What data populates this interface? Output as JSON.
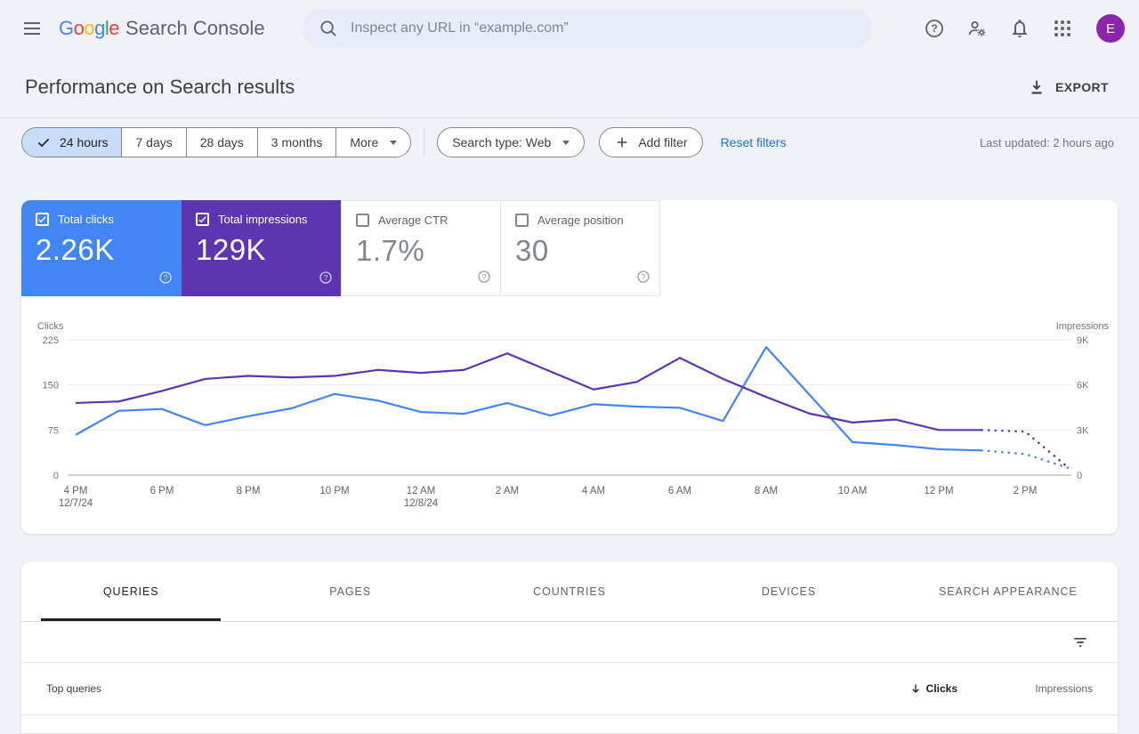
{
  "topbar": {
    "logo_letters": [
      "G",
      "o",
      "o",
      "g",
      "l",
      "e"
    ],
    "logo_product": "Search Console",
    "search_placeholder": "Inspect any URL in “example.com”",
    "avatar_letter": "E"
  },
  "header": {
    "title": "Performance on Search results",
    "export_label": "EXPORT"
  },
  "filters": {
    "date_chips": [
      {
        "label": "24 hours",
        "selected": true
      },
      {
        "label": "7 days",
        "selected": false
      },
      {
        "label": "28 days",
        "selected": false
      },
      {
        "label": "3 months",
        "selected": false
      },
      {
        "label": "More",
        "selected": false,
        "dropdown": true
      }
    ],
    "search_type_label": "Search type: Web",
    "add_filter_label": "Add filter",
    "reset_label": "Reset filters",
    "last_updated": "Last updated: 2 hours ago"
  },
  "metrics": [
    {
      "label": "Total clicks",
      "value": "2.26K",
      "checked": true,
      "color": "#4285f4"
    },
    {
      "label": "Total impressions",
      "value": "129K",
      "checked": true,
      "color": "#5e35b1"
    },
    {
      "label": "Average CTR",
      "value": "1.7%",
      "checked": false,
      "color": "#ffffff"
    },
    {
      "label": "Average position",
      "value": "30",
      "checked": false,
      "color": "#ffffff"
    }
  ],
  "chart_data": {
    "type": "line",
    "left_axis": {
      "title": "Clicks",
      "ticks": [
        0,
        75,
        150,
        225
      ],
      "max": 225
    },
    "right_axis": {
      "title": "Impressions",
      "ticks": [
        "0",
        "3K",
        "6K",
        "9K"
      ],
      "max": 9000
    },
    "x_tick_labels": [
      "4 PM",
      "6 PM",
      "8 PM",
      "10 PM",
      "12 AM",
      "2 AM",
      "4 AM",
      "6 AM",
      "8 AM",
      "10 AM",
      "12 PM",
      "2 PM"
    ],
    "x_tick_sub": {
      "0": "12/7/24",
      "4": "12/8/24"
    },
    "hours": [
      "4 PM",
      "5 PM",
      "6 PM",
      "7 PM",
      "8 PM",
      "9 PM",
      "10 PM",
      "11 PM",
      "12 AM",
      "1 AM",
      "2 AM",
      "3 AM",
      "4 AM",
      "5 AM",
      "6 AM",
      "7 AM",
      "8 AM",
      "9 AM",
      "10 AM",
      "11 AM",
      "12 PM",
      "1 PM",
      "2 PM",
      "3 PM"
    ],
    "dotted_from_index": 21,
    "grid": true,
    "series": [
      {
        "name": "Total clicks",
        "axis": "left",
        "color": "#4285f4",
        "values": [
          67,
          107,
          110,
          83,
          98,
          111,
          135,
          124,
          105,
          102,
          120,
          99,
          118,
          114,
          112,
          90,
          213,
          134,
          55,
          50,
          43,
          41,
          35,
          12
        ]
      },
      {
        "name": "Total impressions",
        "axis": "right",
        "color": "#5e35b1",
        "values": [
          4800,
          4900,
          5600,
          6400,
          6600,
          6500,
          6600,
          7000,
          6800,
          7000,
          8100,
          6900,
          5700,
          6200,
          7800,
          6400,
          5200,
          4100,
          3500,
          3700,
          3000,
          3000,
          2900,
          500
        ]
      }
    ]
  },
  "tabs": [
    {
      "label": "QUERIES",
      "active": true
    },
    {
      "label": "PAGES",
      "active": false
    },
    {
      "label": "COUNTRIES",
      "active": false
    },
    {
      "label": "DEVICES",
      "active": false
    },
    {
      "label": "SEARCH APPEARANCE",
      "active": false
    }
  ],
  "table": {
    "row_label": "Top queries",
    "col_clicks": "Clicks",
    "col_impressions": "Impressions"
  }
}
